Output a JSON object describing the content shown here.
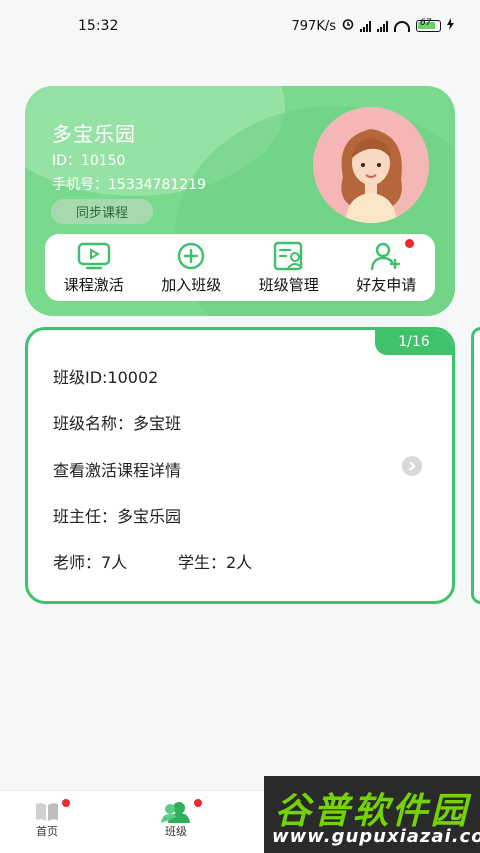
{
  "status_bar": {
    "time": "15:32",
    "network_speed": "797K/s",
    "battery_level": "67",
    "icons": [
      "alarm-icon",
      "signal-icon",
      "signal-icon",
      "wifi-icon",
      "battery-icon",
      "charging-icon"
    ]
  },
  "profile": {
    "name": "多宝乐园",
    "id_line": "ID：10150",
    "phone_line": "手机号：15334781219",
    "sync_button": "同步课程",
    "card_color": "#79d98d"
  },
  "actions": [
    {
      "label": "课程激活",
      "icon": "video-play-icon"
    },
    {
      "label": "加入班级",
      "icon": "plus-circle-icon"
    },
    {
      "label": "班级管理",
      "icon": "class-manage-icon"
    },
    {
      "label": "好友申请",
      "icon": "add-friend-icon",
      "badge": true
    }
  ],
  "class_card": {
    "page_indicator": "1/16",
    "class_id": "班级ID:10002",
    "class_name": "班级名称：多宝班",
    "course_detail": "查看激活课程详情",
    "head_teacher": "班主任：多宝乐园",
    "teachers": "老师：7人",
    "students": "学生：2人",
    "accent_color": "#3fc26c"
  },
  "bottom_nav": {
    "home_label": "首页",
    "class_label": "班级"
  },
  "watermark": {
    "title": "谷普软件园",
    "url": "www.gupuxiazai.com"
  }
}
